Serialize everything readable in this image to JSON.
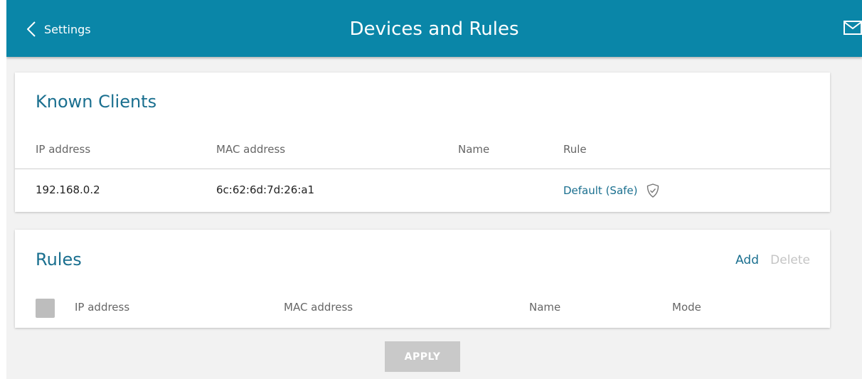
{
  "header": {
    "back_label": "Settings",
    "title": "Devices and Rules",
    "back_icon": "chevron-left-icon",
    "mail_icon": "envelope-icon"
  },
  "known_clients": {
    "title": "Known Clients",
    "columns": [
      "IP address",
      "MAC address",
      "Name",
      "Rule"
    ],
    "rows": [
      {
        "ip": "192.168.0.2",
        "mac": "6c:62:6d:7d:26:a1",
        "name": "",
        "rule": "Default (Safe)",
        "rule_icon": "shield-check-icon"
      }
    ]
  },
  "rules": {
    "title": "Rules",
    "add_label": "Add",
    "delete_label": "Delete",
    "columns": [
      "IP address",
      "MAC address",
      "Name",
      "Mode"
    ]
  },
  "apply_label": "APPLY",
  "colors": {
    "header_bg": "#0a86a8",
    "accent_text": "#1a6f8f",
    "disabled": "#c9c9c9",
    "page_bg": "#f2f2f2"
  }
}
